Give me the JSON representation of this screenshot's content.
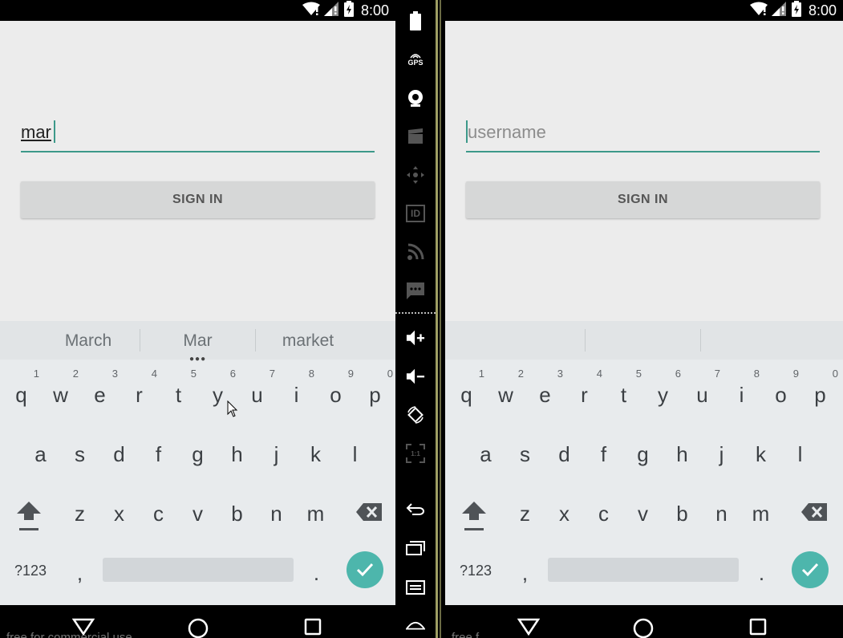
{
  "status_bar": {
    "time": "8:00"
  },
  "left": {
    "username_value": "mar",
    "signin_label": "SIGN IN",
    "suggestions": [
      "March",
      "Mar",
      "market"
    ]
  },
  "right": {
    "username_placeholder": "username",
    "signin_label": "SIGN IN",
    "suggestions": [
      "",
      "",
      ""
    ]
  },
  "keyboard": {
    "row1": [
      {
        "ch": "q",
        "hint": "1"
      },
      {
        "ch": "w",
        "hint": "2"
      },
      {
        "ch": "e",
        "hint": "3"
      },
      {
        "ch": "r",
        "hint": "4"
      },
      {
        "ch": "t",
        "hint": "5"
      },
      {
        "ch": "y",
        "hint": "6"
      },
      {
        "ch": "u",
        "hint": "7"
      },
      {
        "ch": "i",
        "hint": "8"
      },
      {
        "ch": "o",
        "hint": "9"
      },
      {
        "ch": "p",
        "hint": "0"
      }
    ],
    "row2": [
      "a",
      "s",
      "d",
      "f",
      "g",
      "h",
      "j",
      "k",
      "l"
    ],
    "row3": [
      "z",
      "x",
      "c",
      "v",
      "b",
      "n",
      "m"
    ],
    "symbols_label": "?123",
    "comma_label": ",",
    "period_label": ".",
    "icons": {
      "shift": "shift-icon",
      "backspace": "backspace-icon",
      "enter": "check-icon"
    }
  },
  "emulator_sidebar": {
    "buttons": [
      "battery-icon",
      "gps-icon",
      "camera-icon",
      "media-icon",
      "dpad-icon",
      "device-id-icon",
      "network-icon",
      "sms-icon",
      "volume-up-icon",
      "volume-down-icon",
      "rotate-icon",
      "scale-icon",
      "back-icon",
      "recents-icon",
      "menu-icon",
      "home-icon"
    ],
    "gps_label": "GPS",
    "id_label": "ID",
    "scale_label": "1:1"
  },
  "background_text": {
    "left": "free for commercial use",
    "right": "free f"
  },
  "colors": {
    "accent": "#3d998a",
    "app_bg": "#ececec",
    "keyboard_bg": "#e8ebed",
    "enter_key": "#4db6ac"
  }
}
